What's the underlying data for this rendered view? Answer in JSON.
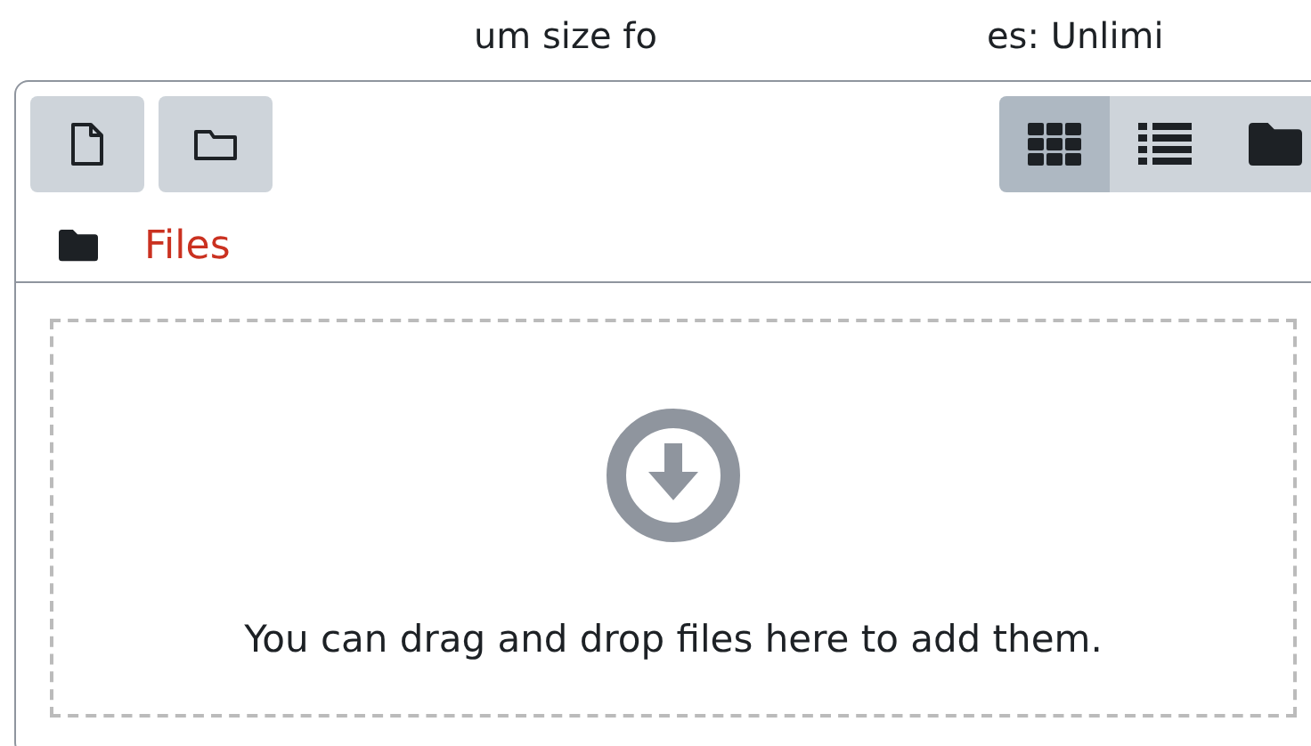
{
  "limit_text": [
    "um size fo",
    "es: Unlimi"
  ],
  "toolbar": {
    "actions": [
      {
        "kind": "file"
      },
      {
        "kind": "folder"
      }
    ],
    "views": [
      {
        "kind": "grid",
        "selected": true
      },
      {
        "kind": "list",
        "selected": false
      },
      {
        "kind": "tree",
        "selected": false
      }
    ]
  },
  "path": {
    "label": "Files"
  },
  "dropzone": {
    "text": "You can drag and drop files here to add them."
  }
}
